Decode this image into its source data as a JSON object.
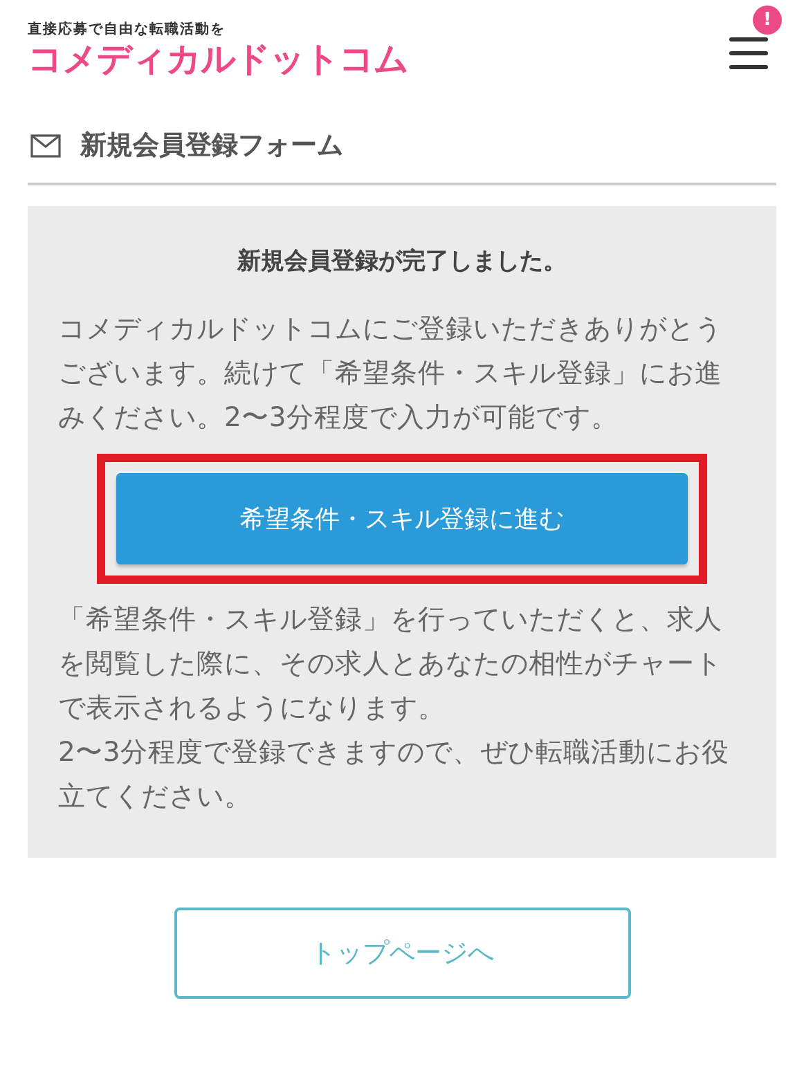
{
  "header": {
    "tagline": "直接応募で自由な転職活動を",
    "logo": "コメディカルドットコム",
    "menu": {
      "badge": "!"
    }
  },
  "section": {
    "title": "新規会員登録フォーム"
  },
  "panel": {
    "heading": "新規会員登録が完了しました。",
    "intro": "コメディカルドットコムにご登録いただきありがとうございます。続けて「希望条件・スキル登録」にお進みください。2〜3分程度で入力が可能です。",
    "cta": {
      "label": "希望条件・スキル登録に進む",
      "highlighted": true
    },
    "notes": [
      "「希望条件・スキル登録」を行っていただくと、求人を閲覧した際に、その求人とあなたの相性がチャートで表示されるようになります。",
      "2〜3分程度で登録できますので、ぜひ転職活動にお役立てください。"
    ]
  },
  "footer_button": "トップページへ"
}
